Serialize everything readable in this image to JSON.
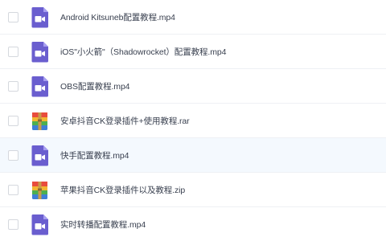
{
  "files": [
    {
      "name": "Android Kitsuneb配置教程.mp4",
      "type": "video"
    },
    {
      "name": "iOS\"小火箭\"（Shadowrocket）配置教程.mp4",
      "type": "video"
    },
    {
      "name": "OBS配置教程.mp4",
      "type": "video"
    },
    {
      "name": "安卓抖音CK登录插件+使用教程.rar",
      "type": "archive"
    },
    {
      "name": "快手配置教程.mp4",
      "type": "video"
    },
    {
      "name": "苹果抖音CK登录插件以及教程.zip",
      "type": "archive"
    },
    {
      "name": "实时转播配置教程.mp4",
      "type": "video"
    }
  ],
  "highlighted_index": 4,
  "colors": {
    "video_icon": "#6a5ecf",
    "highlight_row": "#f4f9fe",
    "text": "#3a4150"
  }
}
